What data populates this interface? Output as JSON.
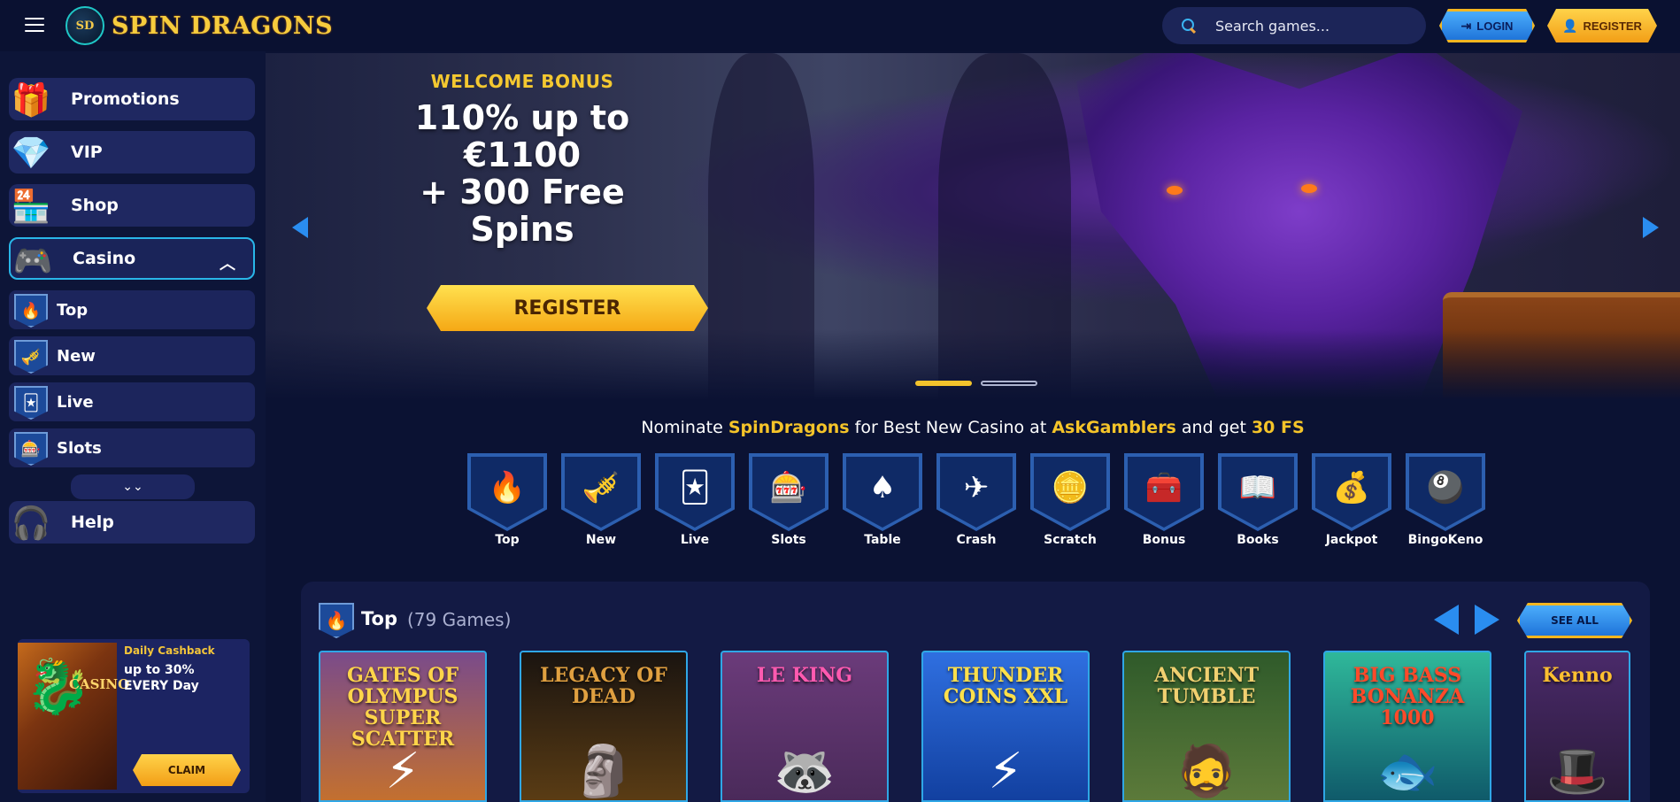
{
  "header": {
    "logo_badge": "SD",
    "logo_text": "SPIN DRAGONS",
    "search_placeholder": "Search games...",
    "login_label": "LOGIN",
    "register_label": "REGISTER"
  },
  "sidebar": {
    "main_items": [
      {
        "label": "Promotions",
        "icon": "gift-icon"
      },
      {
        "label": "VIP",
        "icon": "diamond-icon"
      },
      {
        "label": "Shop",
        "icon": "shop-icon"
      },
      {
        "label": "Casino",
        "icon": "casino-icon"
      }
    ],
    "casino_sub": [
      {
        "label": "Top",
        "icon": "fire-icon"
      },
      {
        "label": "New",
        "icon": "cannon-icon"
      },
      {
        "label": "Live",
        "icon": "cards-icon"
      },
      {
        "label": "Slots",
        "icon": "slot-machine-icon"
      }
    ],
    "help_label": "Help",
    "cashback": {
      "image_text": "CASINO",
      "title": "Daily Cashback",
      "text": "up to 30% EVERY Day",
      "claim_label": "CLAIM"
    }
  },
  "hero": {
    "subtitle": "WELCOME BONUS",
    "title_line1": "110% up to",
    "title_line2": "€1100",
    "title_line3": "+ 300 Free",
    "title_line4": "Spins",
    "register_label": "REGISTER",
    "slide_count": 2,
    "active_slide": 1
  },
  "nominate": {
    "t1": "Nominate ",
    "brand": "SpinDragons",
    "t2": " for Best New Casino at ",
    "site": "AskGamblers",
    "t3": " and get ",
    "reward": "30 FS"
  },
  "categories": [
    {
      "label": "Top",
      "glyph": "🔥"
    },
    {
      "label": "New",
      "glyph": "🎺"
    },
    {
      "label": "Live",
      "glyph": "🃏"
    },
    {
      "label": "Slots",
      "glyph": "🎰"
    },
    {
      "label": "Table",
      "glyph": "♠"
    },
    {
      "label": "Crash",
      "glyph": "✈"
    },
    {
      "label": "Scratch",
      "glyph": "🪙"
    },
    {
      "label": "Bonus",
      "glyph": "🧰"
    },
    {
      "label": "Books",
      "glyph": "📖"
    },
    {
      "label": "Jackpot",
      "glyph": "💰"
    },
    {
      "label": "BingoKeno",
      "glyph": "🎱"
    }
  ],
  "top_section": {
    "title": "Top",
    "count": "(79 Games)",
    "see_all_label": "SEE ALL",
    "games": [
      {
        "title": "Gates of Olympus Super Scatter",
        "display": "GATES OF OLYMPUS SUPER SCATTER"
      },
      {
        "title": "Legacy of Dead",
        "display": "LEGACY OF DEAD"
      },
      {
        "title": "Le King",
        "display": "LE KING"
      },
      {
        "title": "Thunder Coins XXL",
        "display": "THUNDER COINS XXL"
      },
      {
        "title": "Ancient Tumble",
        "display": "ANCIENT TUMBLE"
      },
      {
        "title": "Big Bass Bonanza 1000",
        "display": "BIG BASS BONANZA 1000"
      },
      {
        "title": "Kenno",
        "display": "Kenno"
      }
    ]
  },
  "colors": {
    "accent_gold": "#f5c429",
    "accent_blue": "#2a8df0",
    "background": "#0b1233"
  }
}
